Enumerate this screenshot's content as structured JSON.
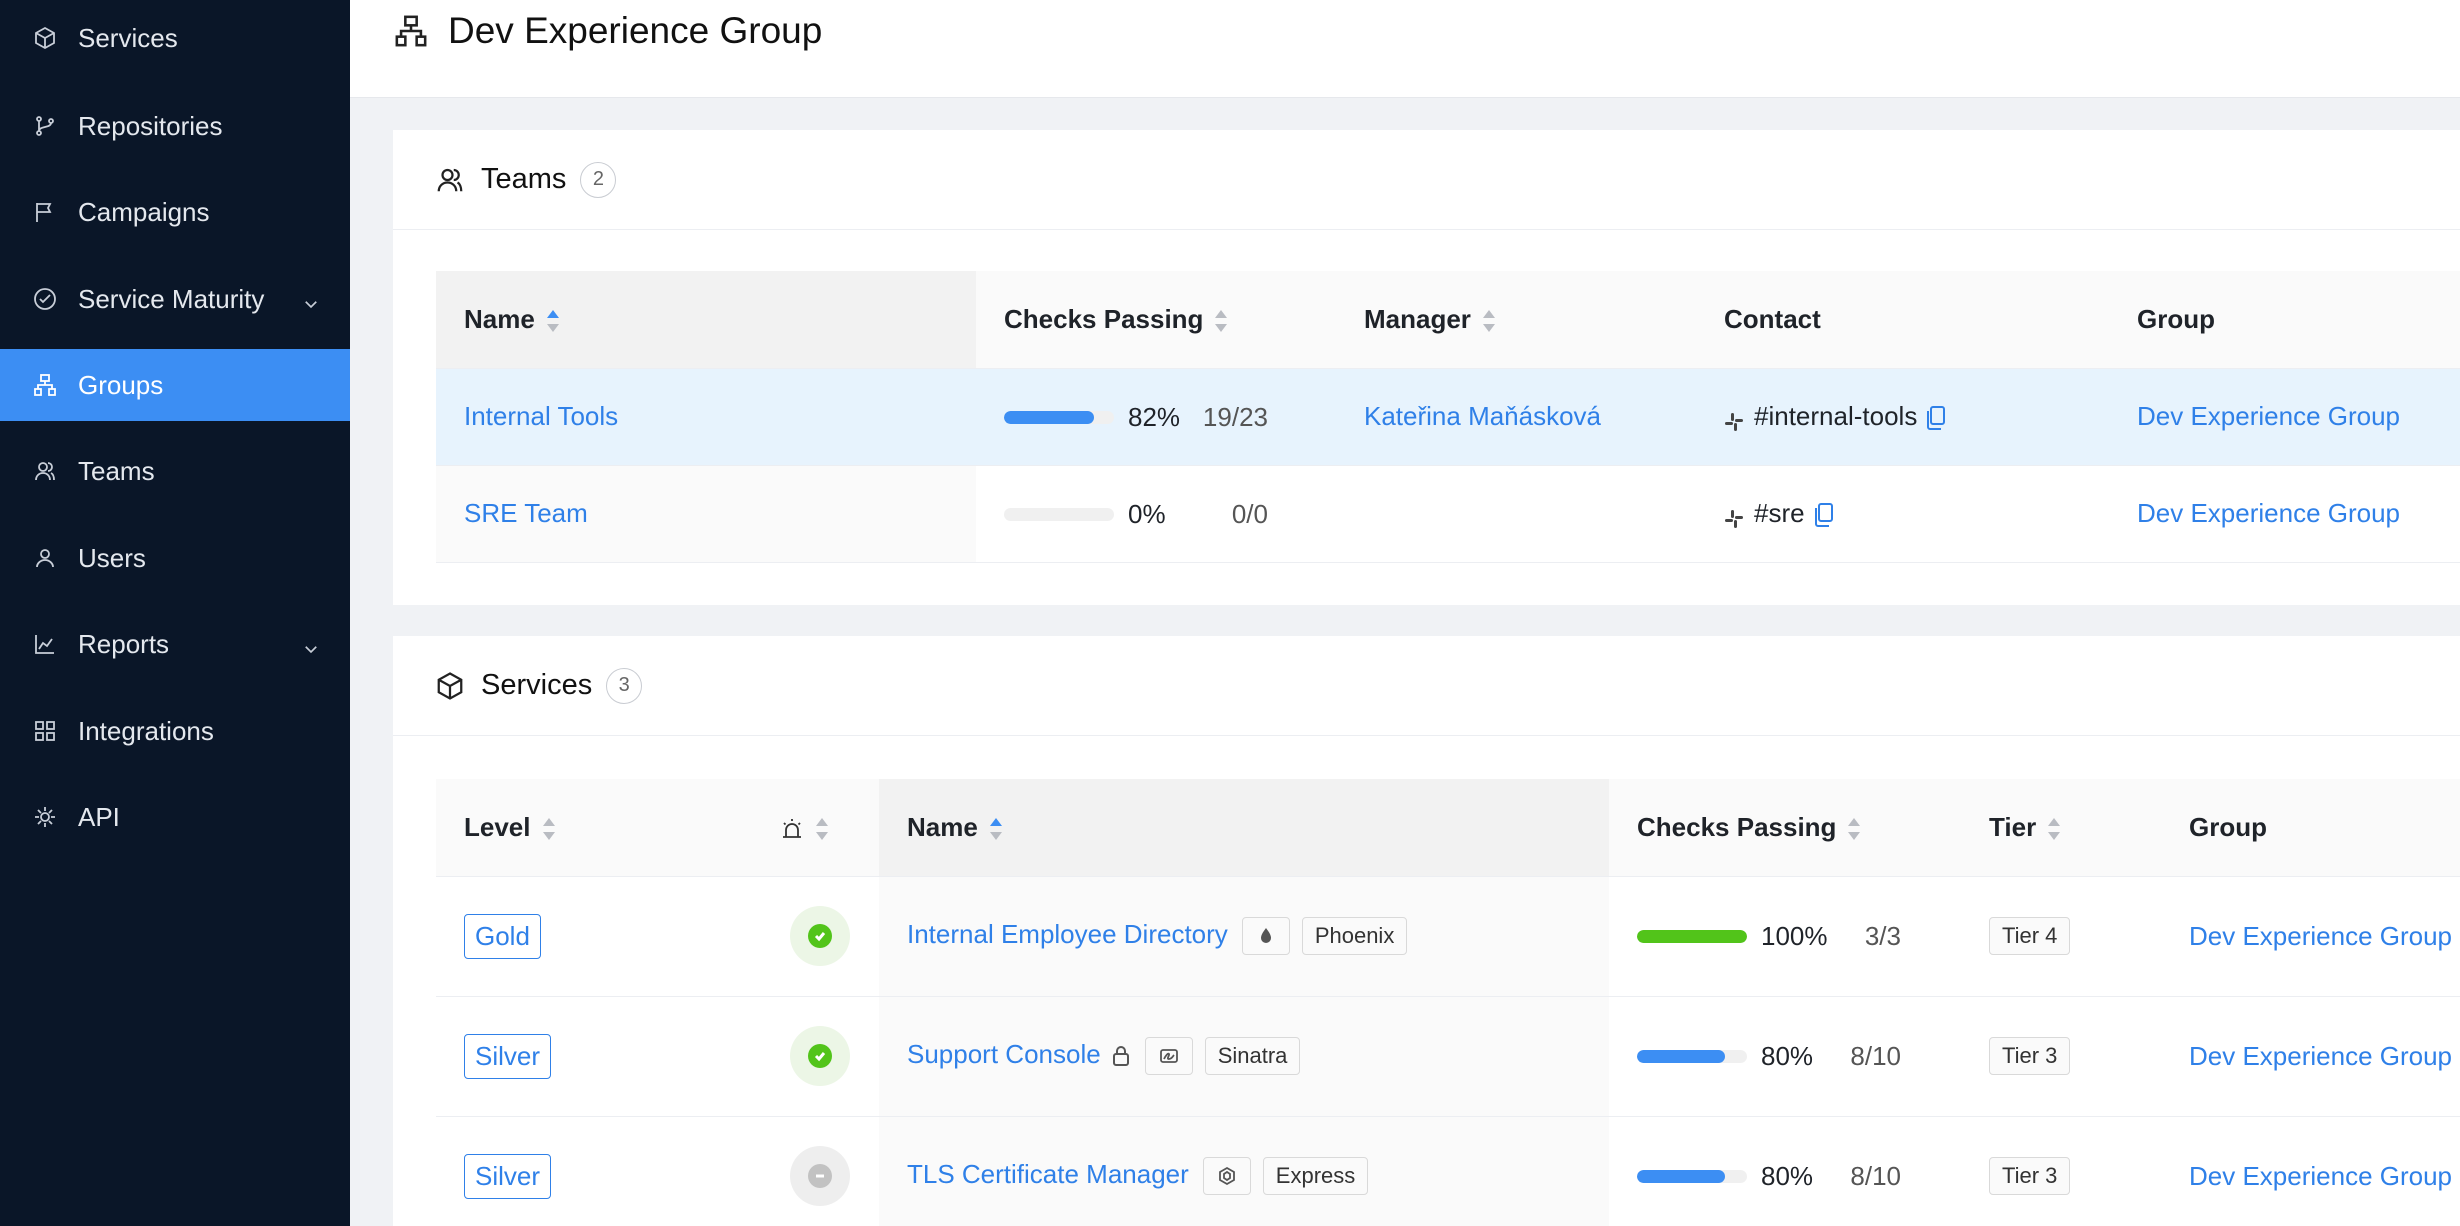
{
  "sidebar": {
    "items": [
      {
        "label": "Services",
        "icon": "cube-icon"
      },
      {
        "label": "Repositories",
        "icon": "branch-icon"
      },
      {
        "label": "Campaigns",
        "icon": "flag-icon"
      },
      {
        "label": "Service Maturity",
        "icon": "check-circle-icon",
        "has_chevron": true
      },
      {
        "label": "Groups",
        "icon": "hierarchy-icon",
        "active": true
      },
      {
        "label": "Teams",
        "icon": "team-icon"
      },
      {
        "label": "Users",
        "icon": "user-icon"
      },
      {
        "label": "Reports",
        "icon": "chart-icon",
        "has_chevron": true
      },
      {
        "label": "Integrations",
        "icon": "grid-icon"
      },
      {
        "label": "API",
        "icon": "api-icon"
      }
    ]
  },
  "page": {
    "title": "Dev Experience Group"
  },
  "teams": {
    "title": "Teams",
    "count": "2",
    "columns": {
      "name": "Name",
      "checks": "Checks Passing",
      "manager": "Manager",
      "contact": "Contact",
      "group": "Group"
    },
    "rows": [
      {
        "name": "Internal Tools",
        "pct_value": 0.82,
        "pct": "82%",
        "ratio": "19/23",
        "manager": "Kateřina Maňásková",
        "contact": "#internal-tools",
        "group": "Dev Experience Group"
      },
      {
        "name": "SRE Team",
        "pct_value": 0,
        "pct": "0%",
        "ratio": "0/0",
        "manager": "",
        "contact": "#sre",
        "group": "Dev Experience Group"
      }
    ]
  },
  "services": {
    "title": "Services",
    "count": "3",
    "columns": {
      "level": "Level",
      "name": "Name",
      "checks": "Checks Passing",
      "tier": "Tier",
      "group": "Group"
    },
    "rows": [
      {
        "level": "Gold",
        "status": "ok",
        "name": "Internal Employee Directory",
        "icon": "drop-icon",
        "framework": "Phoenix",
        "pct_value": 1.0,
        "pct": "100%",
        "ratio": "3/3",
        "tier": "Tier 4",
        "group": "Dev Experience Group",
        "bar_color": "#52c41a"
      },
      {
        "level": "Silver",
        "status": "ok",
        "name": "Support Console",
        "locked": true,
        "icon": "signature-icon",
        "framework": "Sinatra",
        "pct_value": 0.8,
        "pct": "80%",
        "ratio": "8/10",
        "tier": "Tier 3",
        "group": "Dev Experience Group",
        "bar_color": "#3c8ef3"
      },
      {
        "level": "Silver",
        "status": "na",
        "name": "TLS Certificate Manager",
        "icon": "hex-icon",
        "framework": "Express",
        "pct_value": 0.8,
        "pct": "80%",
        "ratio": "8/10",
        "tier": "Tier 3",
        "group": "Dev Experience Group",
        "bar_color": "#3c8ef3"
      }
    ]
  }
}
